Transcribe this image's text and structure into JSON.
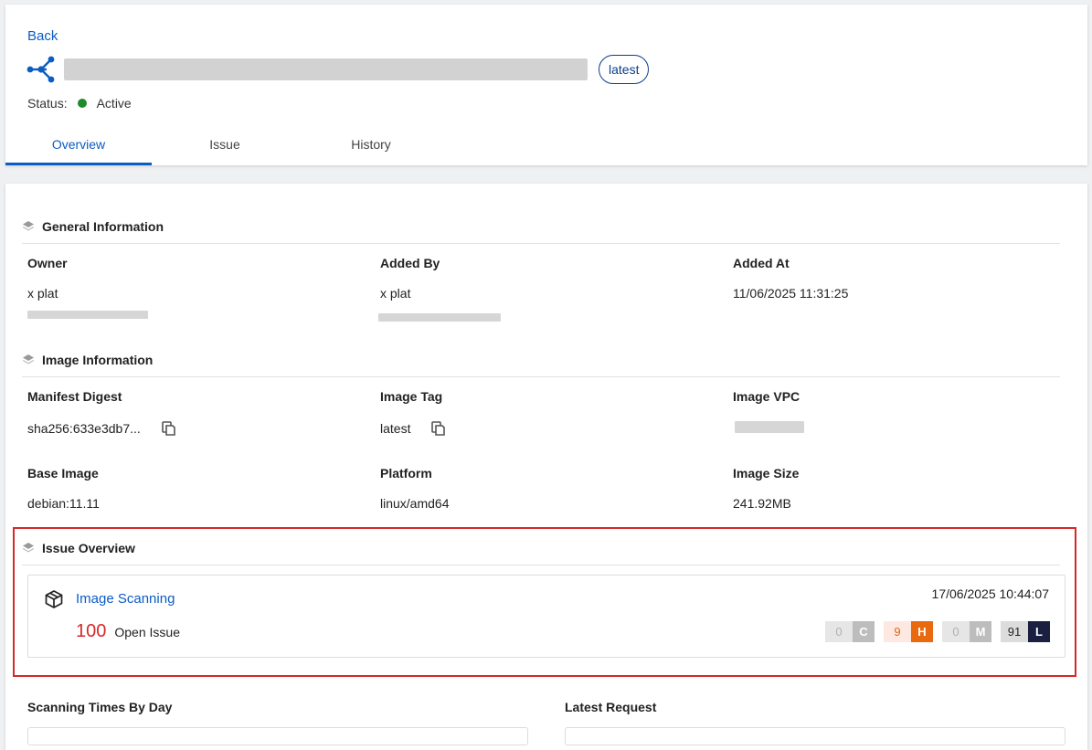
{
  "header": {
    "back_label": "Back",
    "tag": "latest",
    "status_label": "Status:",
    "status_value": "Active",
    "status_color": "#1f8a2a"
  },
  "tabs": [
    {
      "label": "Overview",
      "active": true
    },
    {
      "label": "Issue",
      "active": false
    },
    {
      "label": "History",
      "active": false
    }
  ],
  "general": {
    "title": "General Information",
    "owner_label": "Owner",
    "owner_value": "x plat",
    "added_by_label": "Added By",
    "added_by_value": "x plat",
    "added_at_label": "Added At",
    "added_at_value": "11/06/2025 11:31:25"
  },
  "image": {
    "title": "Image Information",
    "digest_label": "Manifest Digest",
    "digest_value": "sha256:633e3db7...",
    "tag_label": "Image Tag",
    "tag_value": "latest",
    "vpc_label": "Image VPC",
    "base_label": "Base Image",
    "base_value": "debian:11.11",
    "platform_label": "Platform",
    "platform_value": "linux/amd64",
    "size_label": "Image Size",
    "size_value": "241.92MB"
  },
  "issue_overview": {
    "title": "Issue Overview",
    "scan_label": "Image Scanning",
    "scan_date": "17/06/2025 10:44:07",
    "open_count": "100",
    "open_label": "Open Issue",
    "severities": [
      {
        "count": "0",
        "letter": "C",
        "count_bg": "#e6e6e6",
        "count_color": "#b0b0b0",
        "letter_bg": "#bdbdbd"
      },
      {
        "count": "9",
        "letter": "H",
        "count_bg": "#fde9e1",
        "count_color": "#e0661a",
        "letter_bg": "#e8690f"
      },
      {
        "count": "0",
        "letter": "M",
        "count_bg": "#e6e6e6",
        "count_color": "#b0b0b0",
        "letter_bg": "#bdbdbd"
      },
      {
        "count": "91",
        "letter": "L",
        "count_bg": "#dcdcdc",
        "count_color": "#222222",
        "letter_bg": "#1b2040"
      }
    ]
  },
  "bottom": {
    "scan_times_label": "Scanning Times By Day",
    "latest_request_label": "Latest Request"
  },
  "colors": {
    "accent": "#0b5cc4",
    "danger": "#d62828"
  }
}
